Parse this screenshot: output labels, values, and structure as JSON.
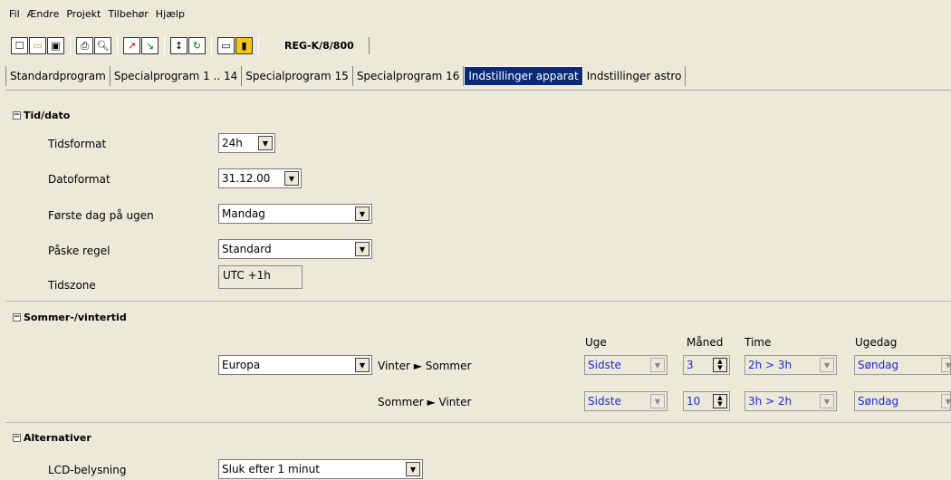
{
  "menu": [
    "Fil",
    "Ændre",
    "Projekt",
    "Tilbehør",
    "Hjælp"
  ],
  "toolbar": {
    "device": "REG-K/8/800",
    "icons": [
      "new-icon",
      "open-icon",
      "save-icon",
      "print-icon",
      "print-preview-icon",
      "upload-icon",
      "download-icon",
      "sort-icon",
      "refresh-icon",
      "window-icon",
      "chart-icon"
    ]
  },
  "tabs": [
    {
      "label": "Standardprogram",
      "active": false
    },
    {
      "label": "Specialprogram 1 .. 14",
      "active": false
    },
    {
      "label": "Specialprogram 15",
      "active": false
    },
    {
      "label": "Specialprogram 16",
      "active": false
    },
    {
      "label": "Indstillinger apparat",
      "active": true
    },
    {
      "label": "Indstillinger astro",
      "active": false
    }
  ],
  "tiddato": {
    "title": "Tid/dato",
    "tidsformat": {
      "label": "Tidsformat",
      "value": "24h"
    },
    "datoformat": {
      "label": "Datoformat",
      "value": "31.12.00"
    },
    "forste_dag": {
      "label": "Første dag på ugen",
      "value": "Mandag"
    },
    "paske": {
      "label": "Påske regel",
      "value": "Standard"
    },
    "tidszone": {
      "label": "Tidszone",
      "value": "UTC +1h"
    }
  },
  "sommer": {
    "title": "Sommer-/vintertid",
    "region": "Europa",
    "col_uge": "Uge",
    "col_maned": "Måned",
    "col_time": "Time",
    "col_ugedag": "Ugedag",
    "row1": {
      "label": "Vinter ► Sommer",
      "uge": "Sidste",
      "maned": "3",
      "time": "2h > 3h",
      "ugedag": "Søndag"
    },
    "row2": {
      "label": "Sommer ► Vinter",
      "uge": "Sidste",
      "maned": "10",
      "time": "3h > 2h",
      "ugedag": "Søndag"
    }
  },
  "alternativer": {
    "title": "Alternativer",
    "lcd": {
      "label": "LCD-belysning",
      "value": "Sluk efter 1 minut"
    }
  }
}
